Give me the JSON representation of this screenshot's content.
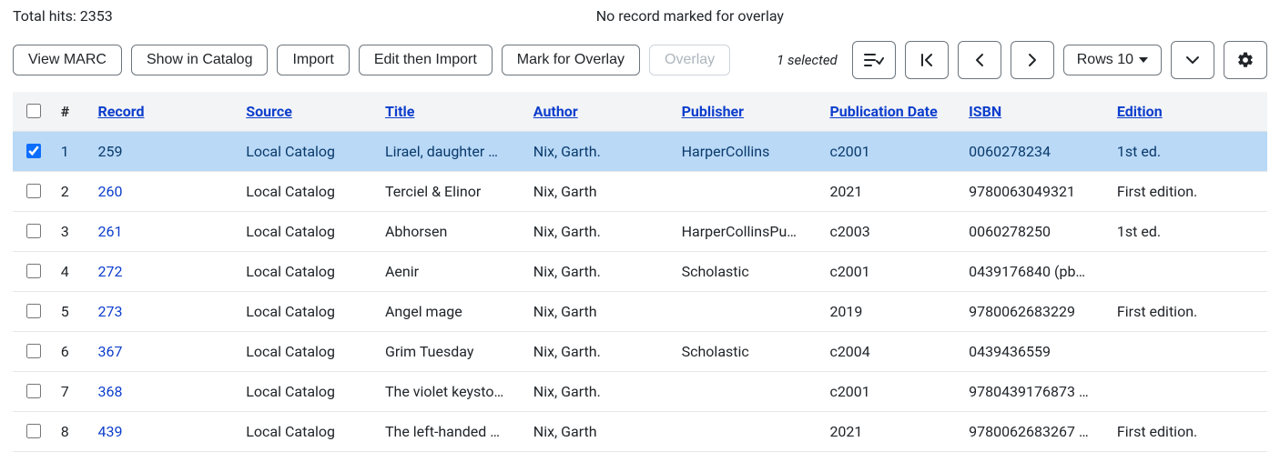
{
  "info": {
    "total_hits_label": "Total hits: 2353",
    "overlay_status": "No record marked for overlay"
  },
  "toolbar": {
    "view_marc": "View MARC",
    "show_in_catalog": "Show in Catalog",
    "import": "Import",
    "edit_then_import": "Edit then Import",
    "mark_for_overlay": "Mark for Overlay",
    "overlay": "Overlay",
    "selected_text": "1 selected",
    "rows_label": "Rows 10"
  },
  "columns": {
    "num": "#",
    "record": "Record",
    "source": "Source",
    "title": "Title",
    "author": "Author",
    "publisher": "Publisher",
    "pub_date": "Publication Date",
    "isbn": "ISBN",
    "edition": "Edition"
  },
  "rows": [
    {
      "n": "1",
      "record": "259",
      "source": "Local Catalog",
      "title": "Lirael, daughter …",
      "author": "Nix, Garth.",
      "publisher": "HarperCollins",
      "pub_date": "c2001",
      "isbn": "0060278234",
      "edition": "1st ed.",
      "selected": true
    },
    {
      "n": "2",
      "record": "260",
      "source": "Local Catalog",
      "title": "Terciel & Elinor",
      "author": "Nix, Garth",
      "publisher": "",
      "pub_date": "2021",
      "isbn": "9780063049321",
      "edition": "First edition.",
      "selected": false
    },
    {
      "n": "3",
      "record": "261",
      "source": "Local Catalog",
      "title": "Abhorsen",
      "author": "Nix, Garth.",
      "publisher": "HarperCollinsPu…",
      "pub_date": "c2003",
      "isbn": "0060278250",
      "edition": "1st ed.",
      "selected": false
    },
    {
      "n": "4",
      "record": "272",
      "source": "Local Catalog",
      "title": "Aenir",
      "author": "Nix, Garth.",
      "publisher": "Scholastic",
      "pub_date": "c2001",
      "isbn": "0439176840 (pb…",
      "edition": "",
      "selected": false
    },
    {
      "n": "5",
      "record": "273",
      "source": "Local Catalog",
      "title": "Angel mage",
      "author": "Nix, Garth",
      "publisher": "",
      "pub_date": "2019",
      "isbn": "9780062683229",
      "edition": "First edition.",
      "selected": false
    },
    {
      "n": "6",
      "record": "367",
      "source": "Local Catalog",
      "title": "Grim Tuesday",
      "author": "Nix, Garth.",
      "publisher": "Scholastic",
      "pub_date": "c2004",
      "isbn": "0439436559",
      "edition": "",
      "selected": false
    },
    {
      "n": "7",
      "record": "368",
      "source": "Local Catalog",
      "title": "The violet keysto…",
      "author": "Nix, Garth.",
      "publisher": "",
      "pub_date": "c2001",
      "isbn": "9780439176873 …",
      "edition": "",
      "selected": false
    },
    {
      "n": "8",
      "record": "439",
      "source": "Local Catalog",
      "title": "The left-handed …",
      "author": "Nix, Garth",
      "publisher": "",
      "pub_date": "2021",
      "isbn": "9780062683267 …",
      "edition": "First edition.",
      "selected": false
    }
  ]
}
